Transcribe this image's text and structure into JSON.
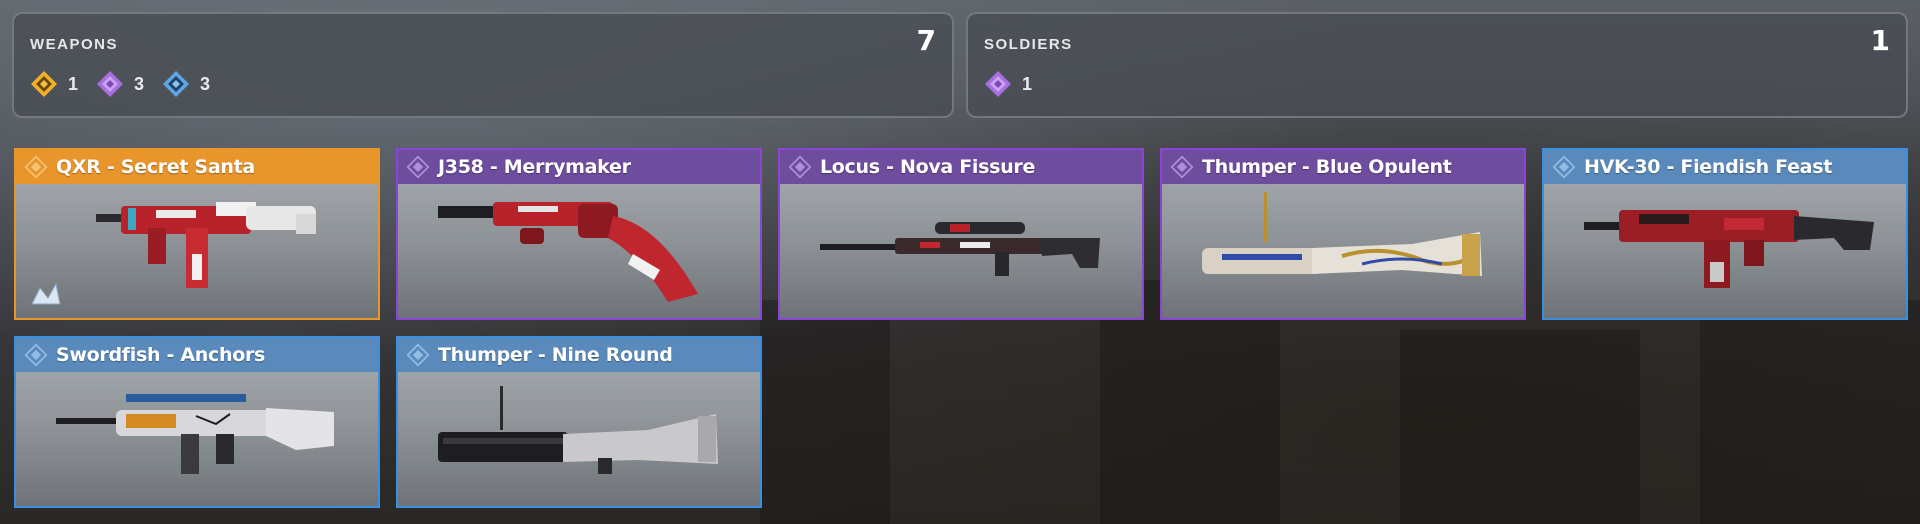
{
  "summary": {
    "weapons": {
      "title": "WEAPONS",
      "total": "7",
      "rarities": [
        {
          "tier": "legendary",
          "icon": "legendary-gem-icon",
          "color": "#f2b32a",
          "count": "1"
        },
        {
          "tier": "epic",
          "icon": "epic-gem-icon",
          "color": "#a86ee0",
          "count": "3"
        },
        {
          "tier": "rare",
          "icon": "rare-gem-icon",
          "color": "#5fa6e8",
          "count": "3"
        }
      ]
    },
    "soldiers": {
      "title": "SOLDIERS",
      "total": "1",
      "rarities": [
        {
          "tier": "epic",
          "icon": "epic-gem-icon",
          "color": "#a86ee0",
          "count": "1"
        }
      ]
    }
  },
  "items": [
    {
      "name": "QXR - Secret Santa",
      "tier": "legendary",
      "weapon_icon": "smg-icon",
      "has_charm": true
    },
    {
      "name": "J358 - Merrymaker",
      "tier": "epic",
      "weapon_icon": "revolver-icon"
    },
    {
      "name": "Locus - Nova Fissure",
      "tier": "epic",
      "weapon_icon": "sniper-rifle-icon"
    },
    {
      "name": "Thumper - Blue Opulent",
      "tier": "epic",
      "weapon_icon": "grenade-launcher-icon"
    },
    {
      "name": "HVK-30 - Fiendish Feast",
      "tier": "rare",
      "weapon_icon": "assault-rifle-icon"
    },
    {
      "name": "Swordfish - Anchors",
      "tier": "rare",
      "weapon_icon": "bullpup-rifle-icon"
    },
    {
      "name": "Thumper - Nine Round",
      "tier": "rare",
      "weapon_icon": "grenade-launcher-icon"
    }
  ],
  "tier_colors": {
    "legendary": "#e8952c",
    "epic": "#8b44d8",
    "rare": "#3a8fe0"
  }
}
